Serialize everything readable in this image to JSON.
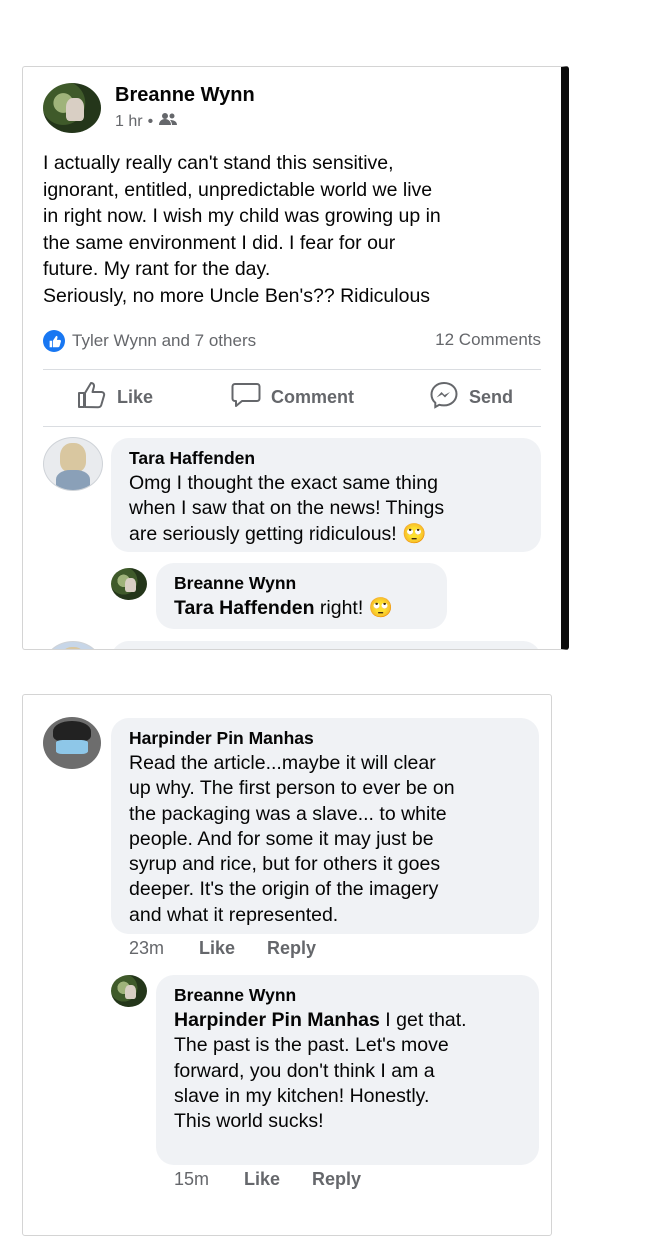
{
  "post": {
    "author": "Breanne Wynn",
    "time": "1 hr",
    "separator": "•",
    "audience_icon": "friends-icon",
    "text": "I actually really can't stand this sensitive,\nignorant, entitled, unpredictable world we live\nin right now. I wish my child was growing up in\nthe same environment I did. I fear for our\nfuture. My rant for the day.\nSeriously, no more Uncle Ben's?? Ridiculous",
    "reactions": "Tyler Wynn and 7 others",
    "comments_count": "12 Comments",
    "actions": {
      "like": "Like",
      "comment": "Comment",
      "send": "Send"
    }
  },
  "comments_top": [
    {
      "author": "Tara Haffenden",
      "text": "Omg I thought the exact same thing\nwhen I saw that on the news! Things\nare seriously getting ridiculous! 🙄"
    },
    {
      "author": "Breanne Wynn",
      "mention": "Tara Haffenden",
      "text": " right! 🙄"
    }
  ],
  "comments_bottom": [
    {
      "author": "Harpinder Pin Manhas",
      "text": "Read the article...maybe it will clear\nup why. The first person to ever be on\nthe packaging was a slave... to white\npeople. And for some it may just be\nsyrup and rice, but for others it goes\ndeeper. It's the origin of the imagery\nand what it represented.",
      "time": "23m",
      "like": "Like",
      "reply": "Reply"
    },
    {
      "author": "Breanne Wynn",
      "mention": "Harpinder Pin Manhas",
      "text": " I get that.\nThe past is the past. Let's move\nforward, you don't think I am a\nslave in my kitchen! Honestly.\nThis world sucks!",
      "time": "15m",
      "like": "Like",
      "reply": "Reply"
    }
  ],
  "colors": {
    "facebook_blue": "#1877f2",
    "bubble": "#f0f2f5",
    "muted": "#65676b"
  }
}
